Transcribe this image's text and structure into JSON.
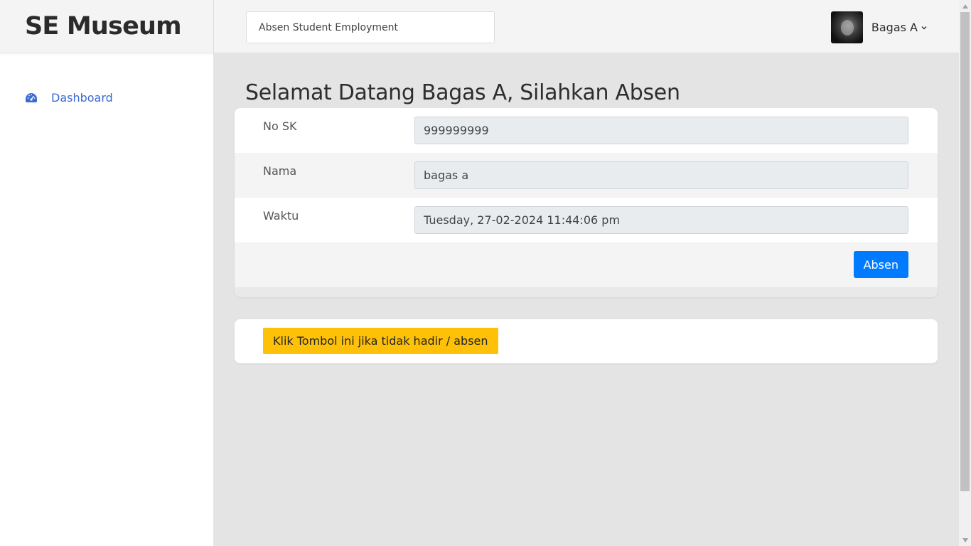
{
  "brand": {
    "title": "SE Museum"
  },
  "sidebar": {
    "items": [
      {
        "label": "Dashboard",
        "icon": "dashboard-gauge-icon"
      }
    ]
  },
  "header": {
    "search_placeholder": "Absen Student Employment",
    "user": {
      "name": "Bagas A"
    }
  },
  "main": {
    "title": "Selamat Datang Bagas A, Silahkan Absen",
    "form": {
      "fields": [
        {
          "label": "No SK",
          "value": "999999999"
        },
        {
          "label": "Nama",
          "value": "bagas a"
        },
        {
          "label": "Waktu",
          "value": "Tuesday, 27-02-2024 11:44:06 pm"
        }
      ],
      "submit_label": "Absen"
    },
    "absent_button_label": "Klik Tombol ini jika tidak hadir / absen"
  },
  "colors": {
    "accent_blue": "#007bff",
    "warning_yellow": "#ffc107",
    "link_blue": "#3a6ad4"
  }
}
